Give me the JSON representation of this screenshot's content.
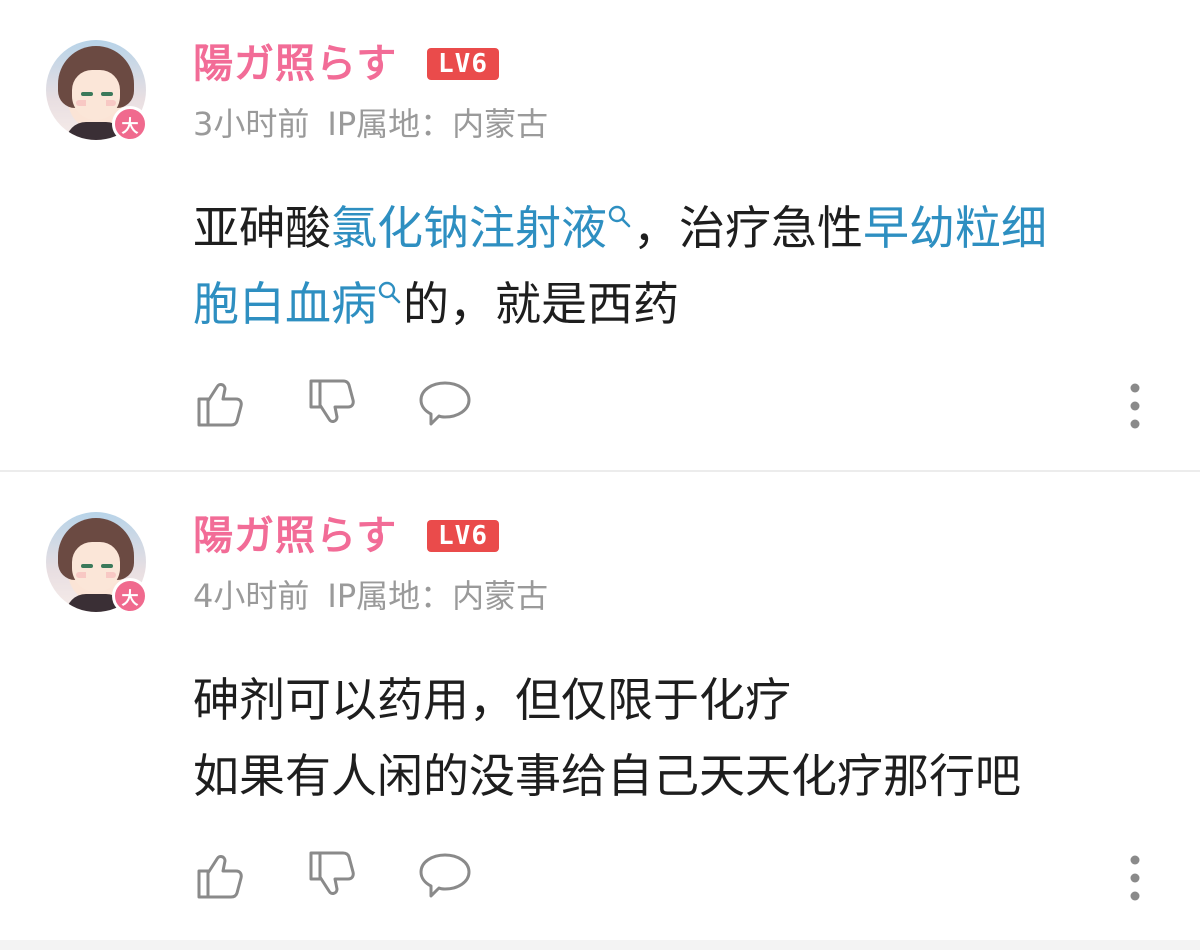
{
  "comments": [
    {
      "username": "陽ガ照らす",
      "level": "LV6",
      "avatar_badge": "大",
      "time": "3小时前",
      "ip_location": "IP属地：内蒙古",
      "content": {
        "seg1": "亚砷酸",
        "link1": "氯化钠注射液",
        "seg2": "，治疗急性",
        "link2a": "早幼粒细",
        "link2b": "胞白血病",
        "seg3": "的，就是西药"
      }
    },
    {
      "username": "陽ガ照らす",
      "level": "LV6",
      "avatar_badge": "大",
      "time": "4小时前",
      "ip_location": "IP属地：内蒙古",
      "content": {
        "line1": "砷剂可以药用，但仅限于化疗",
        "line2": "如果有人闲的没事给自己天天化疗那行吧"
      }
    }
  ],
  "icons": {
    "like": "thumbs-up-icon",
    "dislike": "thumbs-down-icon",
    "reply": "speech-bubble-icon",
    "more": "more-vertical-icon",
    "link_search": "search-icon"
  },
  "colors": {
    "username": "#f26c97",
    "level_badge": "#ea4b4b",
    "link": "#2e8fc1",
    "meta": "#9a9a9a",
    "text": "#1e1e1e"
  }
}
